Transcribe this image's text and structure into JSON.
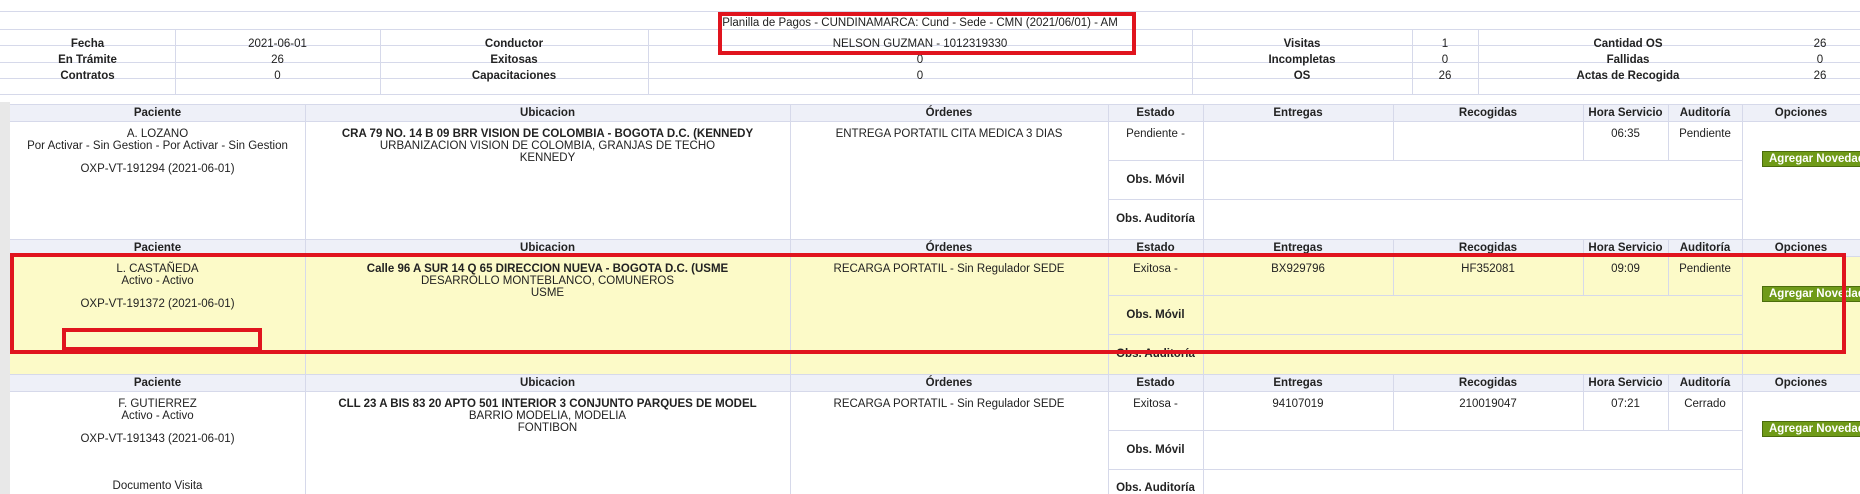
{
  "summary": {
    "title": "Planilla de Pagos - CUNDINAMARCA: Cund - Sede - CMN (2021/06/01) - AM",
    "conductor_value": "NELSON GUZMAN - 1012319330",
    "rows": [
      {
        "l1": "Fecha",
        "v1": "2021-06-01",
        "l2": "Conductor",
        "v2": "",
        "l3": "Visitas",
        "v3": "1",
        "l4": "Cantidad OS",
        "v4": "26"
      },
      {
        "l1": "En Trámite",
        "v1": "26",
        "l2": "Exitosas",
        "v2": "0",
        "l3": "Incompletas",
        "v3": "0",
        "l4": "Fallidas",
        "v4": "0"
      },
      {
        "l1": "Contratos",
        "v1": "0",
        "l2": "Capacitaciones",
        "v2": "0",
        "l3": "OS",
        "v3": "26",
        "l4": "Actas de Recogida",
        "v4": "26"
      }
    ]
  },
  "table_headers": {
    "paciente": "Paciente",
    "ubicacion": "Ubicacion",
    "ordenes": "Órdenes",
    "estado": "Estado",
    "entregas": "Entregas",
    "recogidas": "Recogidas",
    "hora": "Hora Servicio",
    "auditoria": "Auditoría",
    "opciones": "Opciones"
  },
  "labels": {
    "obs_movil": "Obs. Móvil",
    "obs_auditoria": "Obs. Auditoría",
    "agregar_novedad": "Agregar Novedad"
  },
  "visits": [
    {
      "paciente_name": "A. LOZANO",
      "paciente_status": "Por Activar - Sin Gestion - Por Activar - Sin Gestion",
      "paciente_code": "OXP-VT-191294 (2021-06-01)",
      "paciente_extra": "",
      "ubic_line1": "CRA 79 NO. 14 B 09 BRR VISION DE COLOMBIA - BOGOTA D.C. (KENNEDY",
      "ubic_line2": "URBANIZACION VISION DE COLOMBIA, GRANJAS DE TECHO",
      "ubic_line3": "KENNEDY",
      "orden": "ENTREGA PORTATIL CITA MEDICA 3 DIAS",
      "estado": "Pendiente -",
      "entregas": "",
      "recogidas": "",
      "hora": "06:35",
      "auditoria": "Pendiente"
    },
    {
      "paciente_name": "L. CASTAÑEDA",
      "paciente_status": "Activo - Activo",
      "paciente_code": "OXP-VT-191372 (2021-06-01)",
      "paciente_extra": "",
      "ubic_line1": "Calle 96 A SUR 14 Q 65 DIRECCION NUEVA - BOGOTA D.C. (USME",
      "ubic_line2": "DESARROLLO MONTEBLANCO, COMUNEROS",
      "ubic_line3": "USME",
      "orden": "RECARGA PORTATIL - Sin Regulador SEDE",
      "estado": "Exitosa -",
      "entregas": "BX929796",
      "recogidas": "HF352081",
      "hora": "09:09",
      "auditoria": "Pendiente"
    },
    {
      "paciente_name": "F. GUTIERREZ",
      "paciente_status": "Activo - Activo",
      "paciente_code": "OXP-VT-191343 (2021-06-01)",
      "paciente_extra": "Documento Visita",
      "ubic_line1": "CLL 23 A BIS 83 20 APTO 501 INTERIOR 3 CONJUNTO PARQUES DE MODEL",
      "ubic_line2": "BARRIO MODELIA, MODELIA",
      "ubic_line3": "FONTIBON",
      "orden": "RECARGA PORTATIL - Sin Regulador SEDE",
      "estado": "Exitosa -",
      "entregas": "94107019",
      "recogidas": "210019047",
      "hora": "07:21",
      "auditoria": "Cerrado"
    }
  ],
  "colors": {
    "highlight_row": "#fcfac8",
    "button_green": "#6f9a18",
    "annotation_red": "#e0141e"
  }
}
